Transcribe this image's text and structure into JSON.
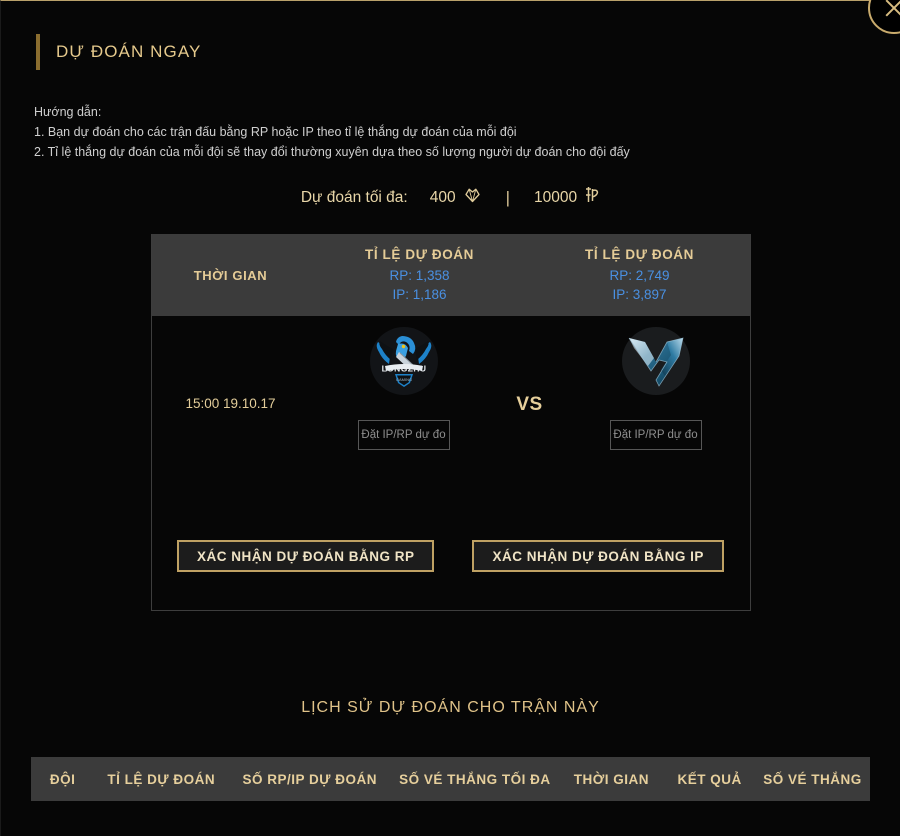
{
  "modal": {
    "title": "DỰ ĐOÁN NGAY",
    "close_label": "×"
  },
  "instructions": {
    "heading": "Hướng dẫn:",
    "line1": "1. Bạn dự đoán cho các trận đấu bằng RP hoặc IP theo tỉ lệ thắng dự đoán của mỗi đội",
    "line2": "2. Tỉ lệ thắng dự đoán của mỗi đội sẽ thay đổi thường xuyên dựa theo số lượng người dự đoán cho đội đấy"
  },
  "max_bet": {
    "label": "Dự đoán tối đa:",
    "rp_amount": "400",
    "separator": "|",
    "ip_amount": "10000",
    "rp_icon": "rp-gem-icon",
    "ip_icon": "ip-coin-icon"
  },
  "match_table": {
    "header": {
      "time_col": "THỜI GIAN",
      "team1_odds_title": "TỈ LỆ DỰ ĐOÁN",
      "team1_rp": "RP: 1,358",
      "team1_ip": "IP: 1,186",
      "team2_odds_title": "TỈ LỆ DỰ ĐOÁN",
      "team2_rp": "RP: 2,749",
      "team2_ip": "IP: 3,897",
      "odds_color": "#4a90e2",
      "accent_color": "#e5cc97"
    },
    "row": {
      "time": "15:00 19.10.17",
      "vs": "VS",
      "team1": {
        "logo_name": "longzhu-gaming-logo",
        "bet_placeholder": "Đặt IP/RP dự đo",
        "bet_value": ""
      },
      "team2": {
        "logo_name": "samsung-galaxy-logo",
        "bet_placeholder": "Đặt IP/RP dự đo",
        "bet_value": ""
      }
    },
    "confirm_rp": "XÁC NHẬN DỰ ĐOÁN BẰNG RP",
    "confirm_ip": "XÁC NHẬN DỰ ĐOÁN BẰNG IP"
  },
  "history": {
    "title": "LỊCH SỬ DỰ ĐOÁN CHO TRẬN NÀY",
    "columns": [
      "ĐỘI",
      "TỈ LỆ DỰ ĐOÁN",
      "SỐ RP/IP DỰ ĐOÁN",
      "SỐ VÉ THẮNG TỐI ĐA",
      "THỜI GIAN",
      "KẾT QUẢ",
      "SỐ VÉ THẮNG"
    ],
    "rows": []
  }
}
